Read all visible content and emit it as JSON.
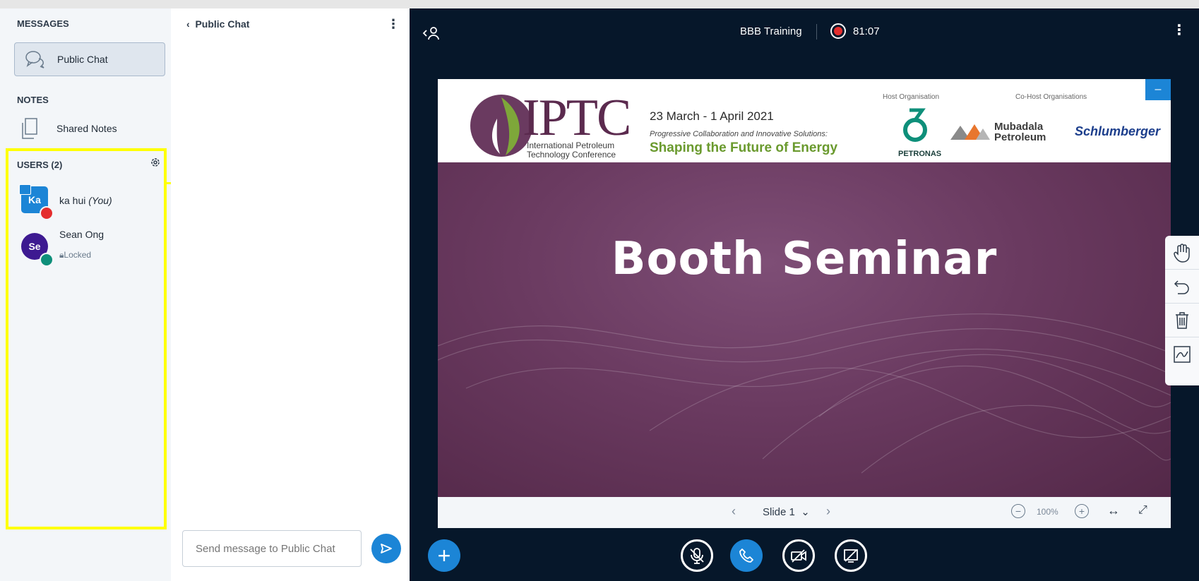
{
  "sidebar": {
    "messages_title": "MESSAGES",
    "public_chat_label": "Public Chat",
    "notes_title": "NOTES",
    "shared_notes_label": "Shared Notes",
    "users_title": "USERS (2)",
    "users": [
      {
        "initials": "Ka",
        "name": "ka hui",
        "you_tag": "(You)",
        "status": ""
      },
      {
        "initials": "Se",
        "name": "Sean Ong",
        "you_tag": "",
        "status": "Locked"
      }
    ]
  },
  "chat": {
    "header": "Public Chat",
    "input_placeholder": "Send message to Public Chat"
  },
  "topbar": {
    "meeting_title": "BBB Training",
    "recording_time": "81:07"
  },
  "slide": {
    "logo_text": "IPTC",
    "logo_sub": "International Petroleum Technology Conference",
    "date": "23 March - 1 April 2021",
    "tagline": "Progressive Collaboration and Innovative Solutions:",
    "slogan": "Shaping the Future of Energy",
    "host_label": "Host Organisation",
    "cohost_label": "Co-Host Organisations",
    "host_name": "PETRONAS",
    "cohost_1": "Mubadala Petroleum",
    "cohost_2": "Schlumberger",
    "title": "Booth Seminar",
    "minimize_label": "–"
  },
  "presentation_toolbar": {
    "slide_label": "Slide 1",
    "zoom": "100%"
  },
  "colors": {
    "accent": "#1c85d6",
    "main_bg": "#06172a",
    "highlight": "#ffff00",
    "recording": "#e42e2e",
    "slide_purple": "#6a3a60"
  }
}
